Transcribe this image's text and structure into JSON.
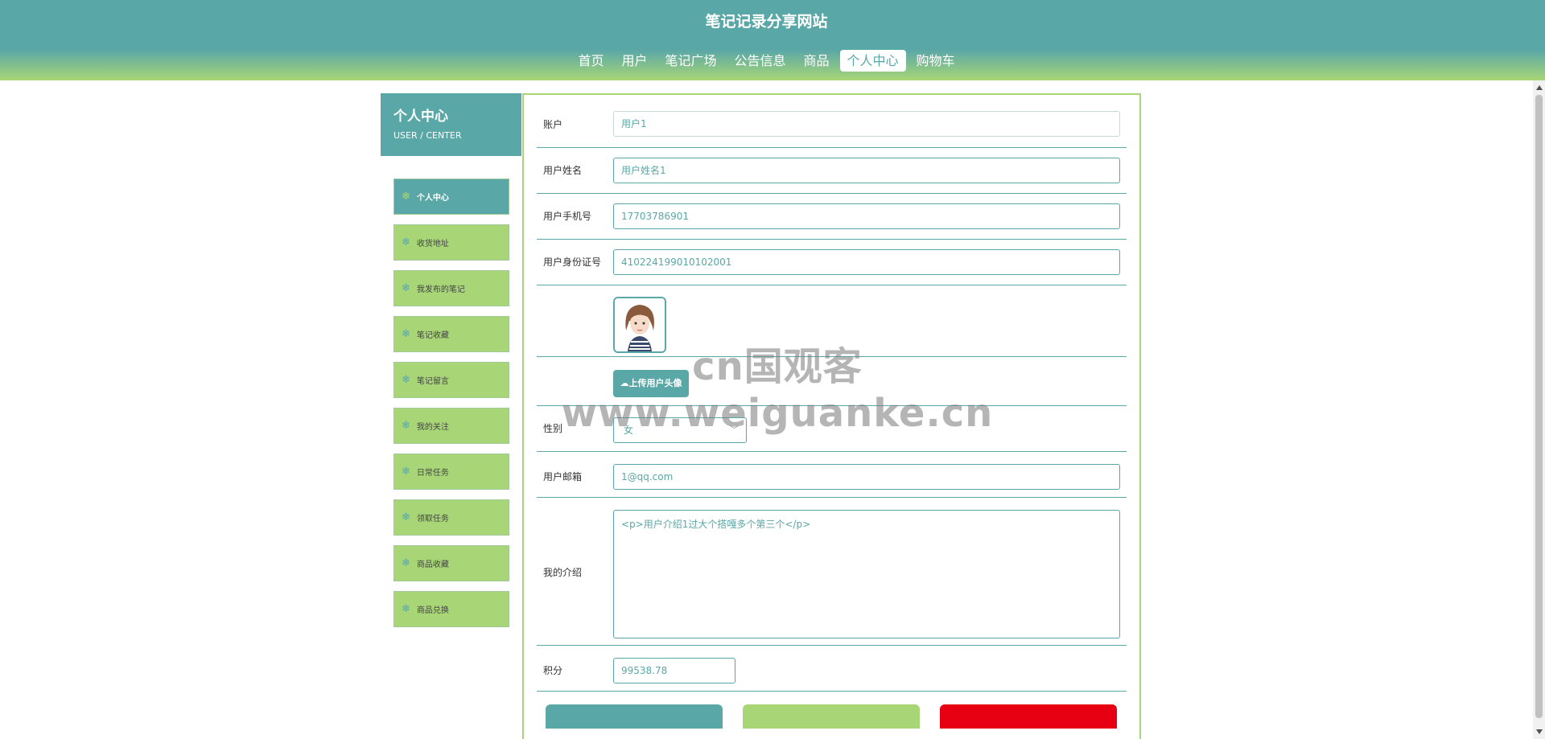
{
  "header": {
    "site_title": "笔记记录分享网站",
    "nav": [
      {
        "label": "首页"
      },
      {
        "label": "用户"
      },
      {
        "label": "笔记广场"
      },
      {
        "label": "公告信息"
      },
      {
        "label": "商品"
      },
      {
        "label": "个人中心",
        "active": true
      },
      {
        "label": "购物车"
      }
    ]
  },
  "sidebar": {
    "title": "个人中心",
    "subtitle": "USER / CENTER",
    "items": [
      {
        "label": "个人中心",
        "active": true
      },
      {
        "label": "收货地址"
      },
      {
        "label": "我发布的笔记"
      },
      {
        "label": "笔记收藏"
      },
      {
        "label": "笔记留言"
      },
      {
        "label": "我的关注"
      },
      {
        "label": "日常任务"
      },
      {
        "label": "领取任务"
      },
      {
        "label": "商品收藏"
      },
      {
        "label": "商品兑换"
      }
    ]
  },
  "form": {
    "account_label": "账户",
    "account_value": "用户1",
    "name_label": "用户姓名",
    "name_value": "用户姓名1",
    "phone_label": "用户手机号",
    "phone_value": "17703786901",
    "idcard_label": "用户身份证号",
    "idcard_value": "410224199010102001",
    "upload_label": "上传用户头像",
    "gender_label": "性别",
    "gender_value": "女",
    "email_label": "用户邮箱",
    "email_value": "1@qq.com",
    "intro_label": "我的介绍",
    "intro_value": "<p>用户介绍1过大个搭嘎多个第三个</p>",
    "points_label": "积分",
    "points_value": "99538.78"
  },
  "watermark": "cn国观客www.weiguanke.cn",
  "colors": {
    "primary": "#5aa7a7",
    "secondary": "#a8d676",
    "danger": "#e60012"
  },
  "icons": {
    "menu_item": "snowflake-icon",
    "upload": "cloud-upload-icon",
    "select": "chevron-down-icon"
  }
}
